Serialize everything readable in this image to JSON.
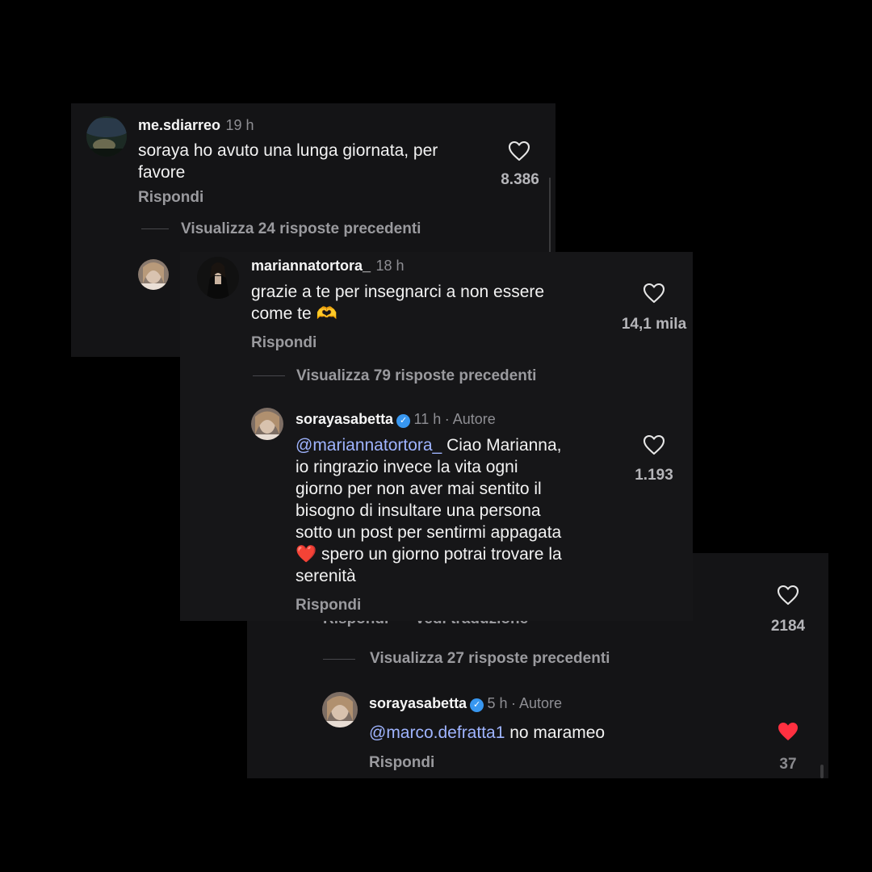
{
  "comment1": {
    "username": "me.sdiarreo",
    "time": "19 h",
    "text_line1": "soraya ho avuto una lunga giornata, per",
    "text_line2": "favore",
    "likes": "8.386",
    "reply": "Rispondi",
    "view_replies": "Visualizza 24 risposte precedenti"
  },
  "comment2": {
    "username": "mariannatortora_",
    "time": "18 h",
    "text_line1": "grazie a te per insegnarci a non essere",
    "text_line2": "come te",
    "emoji": "🫶",
    "likes": "14,1 mila",
    "reply": "Rispondi",
    "view_replies": "Visualizza 79 risposte precedenti"
  },
  "comment3": {
    "username": "sorayasabetta",
    "time": "11 h",
    "author": "· Autore",
    "mention": "@mariannatortora_",
    "line1_rest": " Ciao Marianna,",
    "lines": [
      "io ringrazio invece la vita ogni",
      "giorno per non aver mai sentito il",
      "bisogno di insultare una persona",
      "sotto un post per sentirmi appagata"
    ],
    "heart_emoji": "❤️",
    "line6_rest": " spero un giorno potrai trovare la",
    "line7": "serenità",
    "likes": "1.193",
    "reply": "Rispondi"
  },
  "comment4_partial": {
    "reply": "Rispondi",
    "translation": "Vedi traduzione",
    "likes": "2184",
    "view_replies": "Visualizza 27 risposte precedenti"
  },
  "comment5": {
    "username": "sorayasabetta",
    "time": "5 h",
    "author": "· Autore",
    "mention": "@marco.defratta1",
    "text_rest": " no marameo",
    "reply": "Rispondi",
    "likes": "37"
  },
  "colors": {
    "background": "#000000",
    "panel": "#141416",
    "mention": "#9fb4ff",
    "liked_heart": "#ff3040",
    "verified": "#3897f0"
  }
}
